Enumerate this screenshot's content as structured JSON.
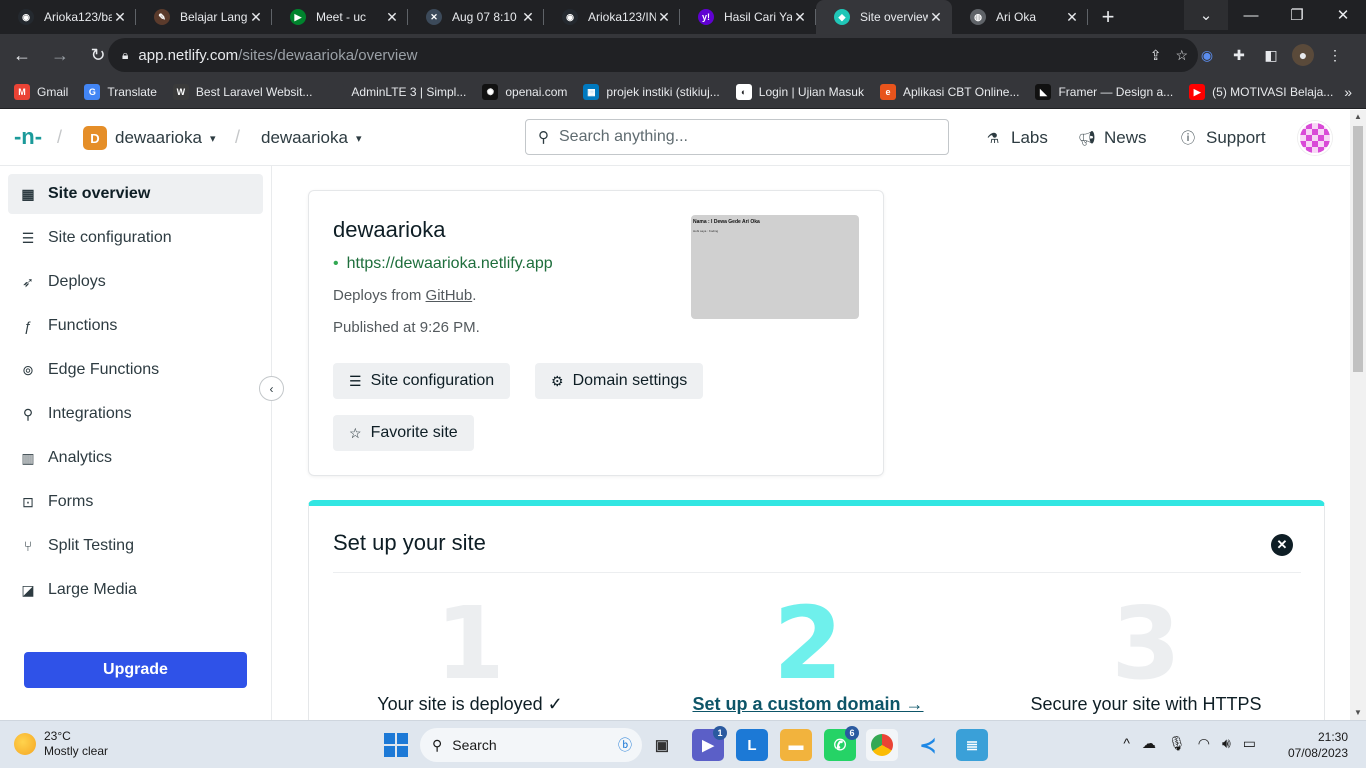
{
  "browser": {
    "tabs": [
      {
        "title": "Arioka123/ba",
        "icon": "github-icon",
        "color": "#24292f",
        "glyph": "◉"
      },
      {
        "title": "Belajar Langk",
        "icon": "quill-icon",
        "color": "#5b3b2c",
        "glyph": "✎"
      },
      {
        "title": "Meet - uc",
        "icon": "meet-icon",
        "color": "#00832d",
        "glyph": "▶"
      },
      {
        "title": "Aug 07 8:10 P",
        "icon": "capcut-icon",
        "color": "#3c4a5a",
        "glyph": "✕"
      },
      {
        "title": "Arioka123/IN",
        "icon": "github-icon",
        "color": "#24292f",
        "glyph": "◉"
      },
      {
        "title": "Hasil Cari Yah",
        "icon": "yahoo-icon",
        "color": "#6001d2",
        "glyph": "y!"
      },
      {
        "title": "Site overview",
        "icon": "netlify-icon",
        "color": "#20c6b7",
        "glyph": "◆",
        "active": true
      },
      {
        "title": "Ari Oka",
        "icon": "globe-icon",
        "color": "#5f6368",
        "glyph": "◍"
      }
    ],
    "url_host": "app.netlify.com",
    "url_path": "/sites/dewaarioka/overview"
  },
  "bookmarks": [
    {
      "label": "Gmail",
      "icon": "gmail-icon",
      "color": "#ea4335",
      "glyph": "M"
    },
    {
      "label": "Translate",
      "icon": "translate-icon",
      "color": "#4285f4",
      "glyph": "G"
    },
    {
      "label": "Best Laravel Websit...",
      "icon": "laravel-icon",
      "color": "#3a3a3a",
      "glyph": "W"
    },
    {
      "label": "AdminLTE 3 | Simpl...",
      "icon": "page-icon",
      "color": "#35363a",
      "glyph": ""
    },
    {
      "label": "openai.com",
      "icon": "openai-icon",
      "color": "#111111",
      "glyph": "✺"
    },
    {
      "label": "projek instiki (stikiuj...",
      "icon": "trello-icon",
      "color": "#0079bf",
      "glyph": "▦"
    },
    {
      "label": "Login | Ujian Masuk",
      "icon": "login-icon",
      "color": "#ffffff",
      "glyph": "◐"
    },
    {
      "label": "Aplikasi CBT Online...",
      "icon": "cbt-icon",
      "color": "#e8541c",
      "glyph": "e"
    },
    {
      "label": "Framer — Design a...",
      "icon": "framer-icon",
      "color": "#111111",
      "glyph": "◣"
    },
    {
      "label": "(5) MOTIVASI Belaja...",
      "icon": "youtube-icon",
      "color": "#ff0000",
      "glyph": "▶"
    }
  ],
  "header": {
    "team_initial": "D",
    "team_name": "dewaarioka",
    "site_name": "dewaarioka",
    "search_placeholder": "Search anything...",
    "labs": "Labs",
    "news": "News",
    "support": "Support"
  },
  "sidebar": {
    "items": [
      {
        "label": "Site overview",
        "icon": "grid-icon",
        "glyph": "▦",
        "active": true
      },
      {
        "label": "Site configuration",
        "icon": "settings-icon",
        "glyph": "☰"
      },
      {
        "label": "Deploys",
        "icon": "rocket-icon",
        "glyph": "➶"
      },
      {
        "label": "Functions",
        "icon": "function-icon",
        "glyph": "ƒ"
      },
      {
        "label": "Edge Functions",
        "icon": "edge-icon",
        "glyph": "⊚"
      },
      {
        "label": "Integrations",
        "icon": "plug-icon",
        "glyph": "⚲"
      },
      {
        "label": "Analytics",
        "icon": "bar-chart-icon",
        "glyph": "▥"
      },
      {
        "label": "Forms",
        "icon": "form-icon",
        "glyph": "⊡"
      },
      {
        "label": "Split Testing",
        "icon": "split-icon",
        "glyph": "⑂"
      },
      {
        "label": "Large Media",
        "icon": "media-icon",
        "glyph": "◪"
      }
    ],
    "upgrade_label": "Upgrade"
  },
  "site_card": {
    "name": "dewaarioka",
    "url": "https://dewaarioka.netlify.app",
    "deploys_prefix": "Deploys from",
    "deploys_source": "GitHub",
    "deploys_suffix": ".",
    "published": "Published at 9:26 PM.",
    "thumb_title": "Nama : I Dewa Gede Ari Oka",
    "thumb_sub": "Hobi saya : Koding",
    "btn_site_config": "Site configuration",
    "btn_domain": "Domain settings",
    "btn_favorite": "Favorite site"
  },
  "setup": {
    "title": "Set up your site",
    "steps": [
      {
        "number": "1",
        "label": "Your site is deployed ✓",
        "current": false
      },
      {
        "number": "2",
        "label": "Set up a custom domain →",
        "current": true
      },
      {
        "number": "3",
        "label": "Secure your site with HTTPS",
        "current": false
      }
    ]
  },
  "taskbar": {
    "temperature": "23°C",
    "weather": "Mostly clear",
    "search_label": "Search",
    "time": "21:30",
    "date": "07/08/2023",
    "teams_badge": "1",
    "whatsapp_badge": "6"
  },
  "colors": {
    "accent": "#2f52e8",
    "teal": "#32e6e2",
    "url_green": "#1e6e3c"
  }
}
